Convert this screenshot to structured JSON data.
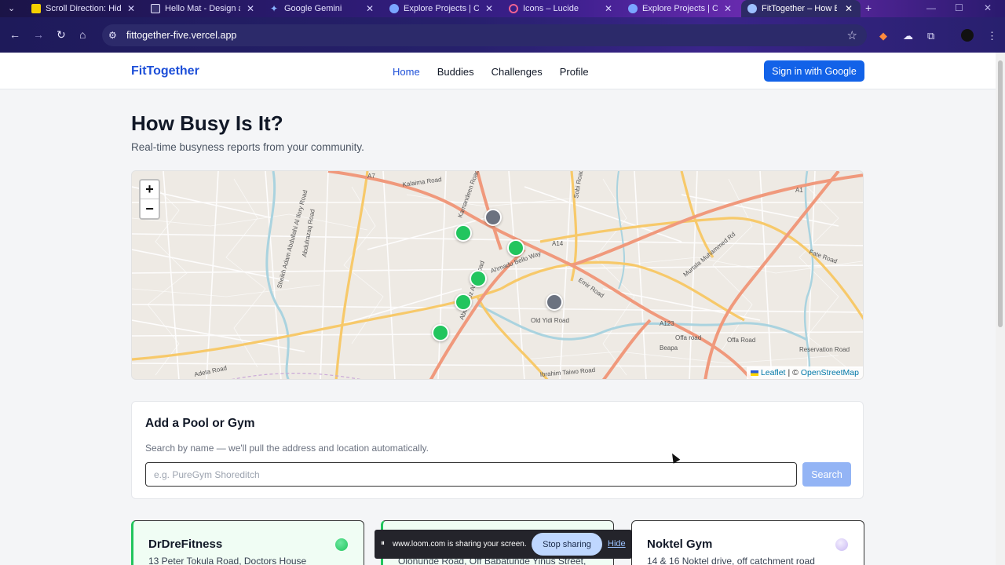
{
  "browser": {
    "tabs": [
      {
        "title": "Scroll Direction: Hide",
        "icon_color": "#f5d000"
      },
      {
        "title": "Hello Mat - Design a",
        "icon_color": "#e8e6ff"
      },
      {
        "title": "Google Gemini",
        "icon_color": "#8ab4ff"
      },
      {
        "title": "Explore Projects | Cy",
        "icon_color": "#7aa6ff"
      },
      {
        "title": "Icons – Lucide",
        "icon_color": "#f06292"
      },
      {
        "title": "Explore Projects | Cy",
        "icon_color": "#7aa6ff"
      },
      {
        "title": "FitTogether – How B",
        "icon_color": "#9ec0ff"
      }
    ],
    "url": "fittogether-five.vercel.app"
  },
  "header": {
    "brand": "FitTogether",
    "nav": [
      "Home",
      "Buddies",
      "Challenges",
      "Profile"
    ],
    "active_nav": "Home",
    "signin_label": "Sign in with Google"
  },
  "hero": {
    "title": "How Busy Is It?",
    "subtitle": "Real-time busyness reports from your community."
  },
  "map": {
    "zoom_in": "+",
    "zoom_out": "−",
    "attribution_leaflet": "Leaflet",
    "attribution_sep": "| ©",
    "attribution_osm": "OpenStreetMap",
    "road_labels": [
      "A7",
      "Kalaima Road",
      "Kamandeen Road",
      "Sobi Road",
      "A1",
      "A14",
      "Emir Road",
      "Old Yidi Road",
      "A123",
      "Offa road",
      "Offa Road",
      "Reservation Road",
      "Fate Road",
      "Murtala Muhammed Rd",
      "Ahmadu Bello Way",
      "Abdul Aziz Attah Road",
      "Ibrahim Taiwo Road",
      "Adeta Road",
      "Sheikh Adam Abdullahi Al Ilory Road",
      "Abdulrazaq Road",
      "Beapa"
    ],
    "marker_colors": {
      "quiet": "#22c55e",
      "unknown": "#6b7280"
    }
  },
  "add_gym": {
    "title": "Add a Pool or Gym",
    "description": "Search by name — we'll pull the address and location automatically.",
    "placeholder": "e.g. PureGym Shoreditch",
    "search_label": "Search"
  },
  "gyms": [
    {
      "name": "DrDreFitness",
      "address": "13 Peter Tokula Road, Doctors House",
      "status_color": "#22c55e"
    },
    {
      "name": "",
      "address": "Olonunde Road, Off Babatunde Yinus Street,",
      "status_color": "#22c55e"
    },
    {
      "name": "Noktel Gym",
      "address": "14 & 16 Noktel drive, off catchment road",
      "status_color": "#d8cdf7"
    }
  ],
  "loom": {
    "message": "www.loom.com is sharing your screen.",
    "stop_label": "Stop sharing",
    "hide_label": "Hide"
  }
}
